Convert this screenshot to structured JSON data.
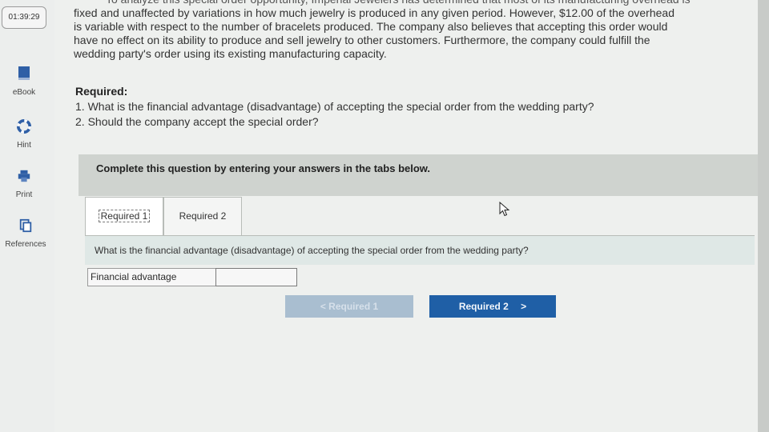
{
  "sidebar": {
    "timer": "01:39:29",
    "tools": [
      {
        "label": "eBook",
        "icon": "book-icon"
      },
      {
        "label": "Hint",
        "icon": "lifebuoy-icon"
      },
      {
        "label": "Print",
        "icon": "printer-icon"
      },
      {
        "label": "References",
        "icon": "references-icon"
      }
    ]
  },
  "problem": {
    "intro_cutoff": "To analyze this special order opportunity, Imperial Jewelers has determined that most of its manufacturing overhead is",
    "intro_lines": [
      "fixed and unaffected by variations in how much jewelry is produced in any given period. However, $12.00 of the overhead",
      "is variable with respect to the number of bracelets produced. The company also believes that accepting this order would",
      "have no effect on its ability to produce and sell jewelry to other customers. Furthermore, the company could fulfill the",
      "wedding party's order using its existing manufacturing capacity."
    ],
    "required_heading": "Required:",
    "required_items": [
      "1. What is the financial advantage (disadvantage) of accepting the special order from the wedding party?",
      "2. Should the company accept the special order?"
    ]
  },
  "answer_area": {
    "instruction": "Complete this question by entering your answers in the tabs below.",
    "tabs": [
      {
        "label": "Required 1",
        "active": true
      },
      {
        "label": "Required 2",
        "active": false
      }
    ],
    "question": "What is the financial advantage (disadvantage) of accepting the special order from the wedding party?",
    "row_label": "Financial advantage",
    "row_value": "",
    "prev_button": "Required 1",
    "next_button": "Required 2",
    "prev_glyph": "<",
    "next_glyph": ">"
  },
  "colors": {
    "next_button": "#1f5fa6",
    "prev_button_disabled": "#a9bed0",
    "instruction_bar": "#cfd3cf"
  }
}
